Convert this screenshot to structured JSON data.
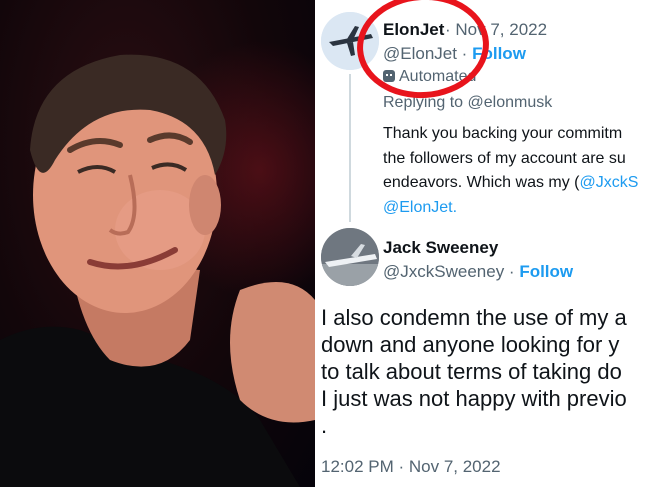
{
  "tweet1": {
    "name": "ElonJet",
    "date": "· Nov 7, 2022",
    "handle": "@ElonJet ·",
    "follow": "Follow",
    "automated": "Automated",
    "reply_to": "Replying to @elonmusk",
    "body_lines": [
      "Thank you backing your commitm",
      "the followers of my account are su",
      "endeavors. Which was my (",
      "@JxckS",
      "@ElonJet."
    ]
  },
  "tweet2": {
    "name": "Jack Sweeney",
    "handle": "@JxckSweeney ·",
    "follow": "Follow",
    "body_lines": [
      "I also condemn the use of my a",
      "down and anyone looking for y",
      "to talk about terms of taking do",
      "I just was not happy with previo",
      "."
    ],
    "timestamp": "12:02 PM · Nov 7, 2022"
  },
  "colors": {
    "annotation_circle": "#e8141c",
    "link": "#1d9bf0",
    "secondary_text": "#536471",
    "photo_background": "#12060a"
  },
  "icons": [
    "robot-icon",
    "avatar-plane-photo",
    "avatar-jet-photo"
  ]
}
